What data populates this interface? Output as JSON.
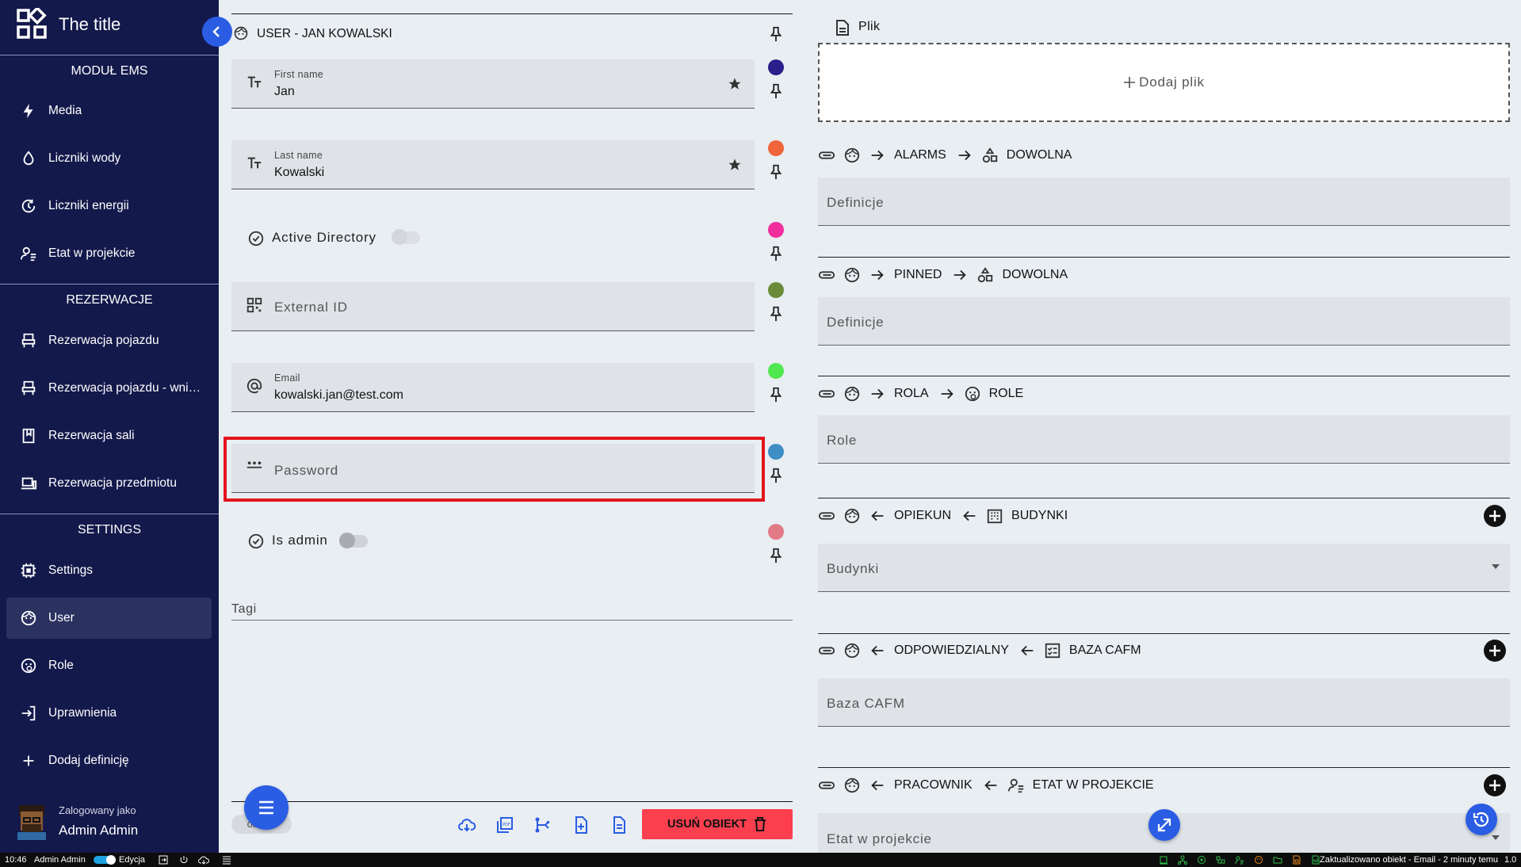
{
  "app": {
    "title": "The title"
  },
  "sidebar": {
    "sections": [
      {
        "title": "MODUŁ EMS",
        "items": [
          {
            "label": "Media",
            "icon": "bolt-icon"
          },
          {
            "label": "Liczniki wody",
            "icon": "water-drop-icon"
          },
          {
            "label": "Liczniki energii",
            "icon": "energy-meter-icon"
          },
          {
            "label": "Etat w projekcie",
            "icon": "person-assignment-icon"
          }
        ]
      },
      {
        "title": "REZERWACJE",
        "items": [
          {
            "label": "Rezerwacja pojazdu",
            "icon": "seat-icon"
          },
          {
            "label": "Rezerwacja pojazdu - wniosek",
            "icon": "seat-icon"
          },
          {
            "label": "Rezerwacja sali",
            "icon": "bookmark-book-icon"
          },
          {
            "label": "Rezerwacja przedmiotu",
            "icon": "laptop-icon"
          }
        ]
      },
      {
        "title": "SETTINGS",
        "items": [
          {
            "label": "Settings",
            "icon": "chip-icon"
          },
          {
            "label": "User",
            "icon": "face-icon",
            "active": true
          },
          {
            "label": "Role",
            "icon": "face-gear-icon"
          },
          {
            "label": "Uprawnienia",
            "icon": "login-icon"
          },
          {
            "label": "Dodaj definicję",
            "icon": "plus-icon"
          }
        ]
      }
    ],
    "user": {
      "logged_as_label": "Zalogowany jako",
      "name": "Admin Admin"
    }
  },
  "form": {
    "header": "USER - JAN KOWALSKI",
    "fields": {
      "first_name": {
        "label": "First name",
        "value": "Jan",
        "color": "#2b1f8c"
      },
      "last_name": {
        "label": "Last name",
        "value": "Kowalski",
        "color": "#f0643c"
      },
      "active_directory": {
        "label": "Active Directory",
        "color": "#f02e9c",
        "checked": false
      },
      "external_id": {
        "placeholder": "External ID",
        "color": "#6a8c3a"
      },
      "email": {
        "label": "Email",
        "value": "kowalski.jan@test.com",
        "color": "#4fe84f"
      },
      "password": {
        "placeholder": "Password",
        "color": "#3e8ec4"
      },
      "is_admin": {
        "label": "Is admin",
        "color": "#e27a85",
        "checked": false
      }
    },
    "tags_label": "Tagi",
    "chip_text": "olxxy9",
    "delete_label": "USUŃ OBIEKT",
    "delete_color": "#fb3f4e",
    "highlight_color": "#e4141c"
  },
  "right": {
    "file": {
      "label": "Plik",
      "add_label": "Dodaj plik"
    },
    "relations": [
      {
        "direction": "forward",
        "rel": "ALARMS",
        "target": "DOWOLNA",
        "placeholder": "Definicje",
        "has_add": false,
        "select": false
      },
      {
        "direction": "forward",
        "rel": "PINNED",
        "target": "DOWOLNA",
        "placeholder": "Definicje",
        "has_add": false,
        "select": false
      },
      {
        "direction": "forward",
        "rel": "ROLA",
        "target": "ROLE",
        "placeholder": "Role",
        "has_add": false,
        "select": false
      },
      {
        "direction": "backward",
        "rel": "OPIEKUN",
        "target": "BUDYNKI",
        "placeholder": "Budynki",
        "has_add": true,
        "select": true
      },
      {
        "direction": "backward",
        "rel": "ODPOWIEDZIALNY",
        "target": "BAZA CAFM",
        "placeholder": "Baza CAFM",
        "has_add": true,
        "select": false
      },
      {
        "direction": "backward",
        "rel": "PRACOWNIK",
        "target": "ETAT W PROJEKCIE",
        "placeholder": "Etat w projekcie",
        "has_add": true,
        "select": true
      }
    ]
  },
  "statusbar": {
    "time": "10:46",
    "user": "Admin Admin",
    "mode": "Edycja",
    "message": "Zaktualizowano obiekt - Email - 2 minuty temu",
    "version": "1.0"
  }
}
